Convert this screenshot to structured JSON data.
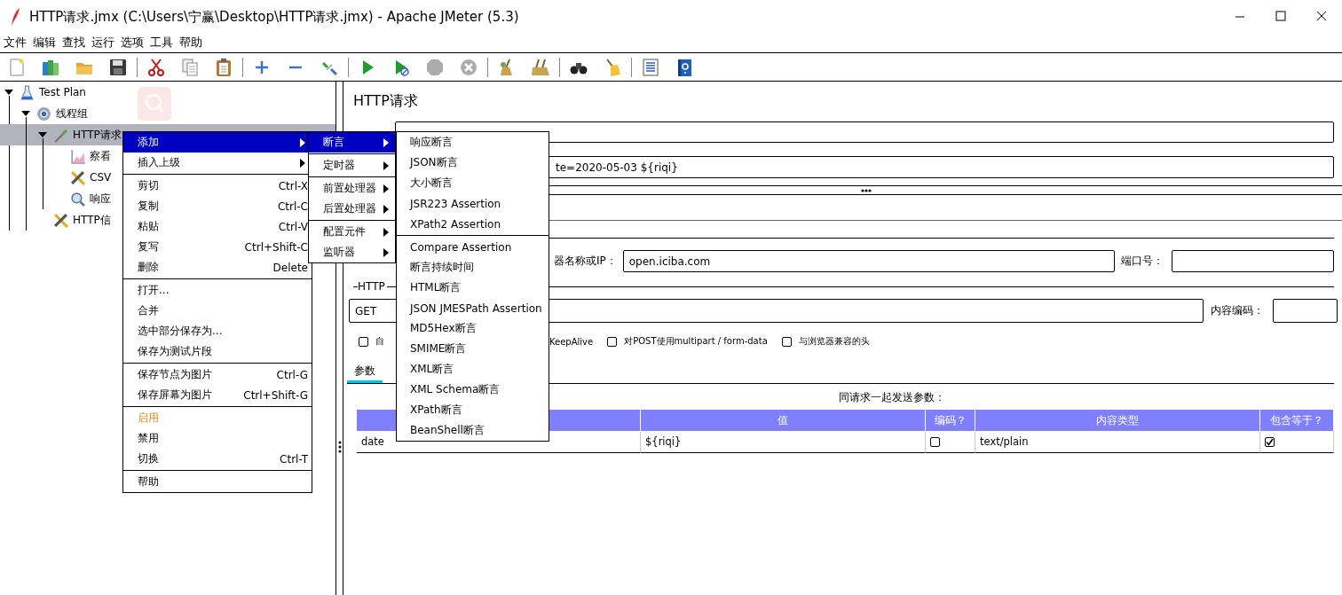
{
  "window": {
    "title": "HTTP请求.jmx (C:\\Users\\宁赢\\Desktop\\HTTP请求.jmx) - Apache JMeter (5.3)"
  },
  "menu_bar": [
    "文件",
    "编辑",
    "查找",
    "运行",
    "选项",
    "工具",
    "帮助"
  ],
  "toolbar": [
    [
      {
        "kind": "new",
        "disabled": false
      },
      {
        "kind": "templates",
        "disabled": false
      },
      {
        "kind": "open",
        "disabled": false
      },
      {
        "kind": "save",
        "disabled": false
      }
    ],
    [
      {
        "kind": "cut",
        "disabled": false
      },
      {
        "kind": "copy",
        "disabled": false
      },
      {
        "kind": "paste",
        "disabled": false
      }
    ],
    [
      {
        "kind": "expand",
        "disabled": false
      },
      {
        "kind": "collapse",
        "disabled": false
      },
      {
        "kind": "toggle",
        "disabled": false
      }
    ],
    [
      {
        "kind": "start",
        "disabled": false
      },
      {
        "kind": "start_no_pauses",
        "disabled": false
      },
      {
        "kind": "stop",
        "disabled": true
      },
      {
        "kind": "shutdown",
        "disabled": true
      }
    ],
    [
      {
        "kind": "clear",
        "disabled": false
      },
      {
        "kind": "clear_all",
        "disabled": false
      }
    ],
    [
      {
        "kind": "search",
        "disabled": false
      },
      {
        "kind": "reset_search",
        "disabled": false
      }
    ],
    [
      {
        "kind": "function_helper",
        "disabled": false
      },
      {
        "kind": "help",
        "disabled": false
      }
    ]
  ],
  "tree": [
    {
      "label": "Test Plan",
      "kind": "test_plan",
      "expanded": true,
      "selected": false,
      "children": [
        {
          "label": "线程组",
          "kind": "thread_group",
          "expanded": true,
          "selected": false,
          "children": [
            {
              "label": "HTTP请求",
              "kind": "sampler",
              "expanded": true,
              "selected": true,
              "children": [
                {
                  "label": "察看",
                  "kind": "listener",
                  "selected": false
                },
                {
                  "label": "CSV",
                  "kind": "config",
                  "selected": false
                },
                {
                  "label": "响应",
                  "kind": "assertion",
                  "selected": false
                }
              ]
            },
            {
              "label": "HTTP信",
              "kind": "config",
              "selected": false
            }
          ]
        }
      ]
    }
  ],
  "editor": {
    "title": "HTTP请求",
    "comment_value": "te=2020-05-03  ${riqi}",
    "server_label": "器名称或IP：",
    "server_value": "open.iciba.com",
    "port_label": "端口号：",
    "section_label": "HTTP",
    "method": "GET",
    "encoding_label": "内容编码：",
    "options": [
      {
        "label": "自",
        "checked": false
      },
      {
        "label": "对POST使用multipart / form-data",
        "checked": false
      },
      {
        "label": "与浏览器兼容的头",
        "checked": false
      }
    ],
    "keepalive_fragment": "KeepAlive",
    "tabs": [
      {
        "label": "参数",
        "selected": true
      }
    ],
    "params_caption": "同请求一起发送参数：",
    "table": {
      "columns": [
        "值",
        "编码？",
        "内容类型",
        "包含等于？"
      ],
      "rows": [
        {
          "name": "date",
          "value": "${riqi}",
          "encode": false,
          "content_type": "text/plain",
          "include_equals": true
        }
      ]
    }
  },
  "context_menu": {
    "groups": [
      [
        {
          "label": "添加",
          "has_submenu": true,
          "selected": true,
          "emphasized": false
        },
        {
          "label": "插入上级",
          "has_submenu": true,
          "selected": false,
          "emphasized": false
        }
      ],
      [
        {
          "label": "剪切",
          "shortcut": "Ctrl-X",
          "selected": false,
          "emphasized": false
        },
        {
          "label": "复制",
          "shortcut": "Ctrl-C",
          "selected": false,
          "emphasized": false
        },
        {
          "label": "粘贴",
          "shortcut": "Ctrl-V",
          "selected": false,
          "emphasized": false
        },
        {
          "label": "复写",
          "shortcut": "Ctrl+Shift-C",
          "selected": false,
          "emphasized": false
        },
        {
          "label": "删除",
          "shortcut": "Delete",
          "selected": false,
          "emphasized": false
        }
      ],
      [
        {
          "label": "打开...",
          "selected": false,
          "emphasized": false
        },
        {
          "label": "合并",
          "selected": false,
          "emphasized": false
        },
        {
          "label": "选中部分保存为...",
          "selected": false,
          "emphasized": false
        },
        {
          "label": "保存为测试片段",
          "selected": false,
          "emphasized": false
        }
      ],
      [
        {
          "label": "保存节点为图片",
          "shortcut": "Ctrl-G",
          "selected": false,
          "emphasized": false
        },
        {
          "label": "保存屏幕为图片",
          "shortcut": "Ctrl+Shift-G",
          "selected": false,
          "emphasized": false
        }
      ],
      [
        {
          "label": "启用",
          "selected": false,
          "emphasized": true
        },
        {
          "label": "禁用",
          "selected": false,
          "emphasized": false
        },
        {
          "label": "切换",
          "shortcut": "Ctrl-T",
          "selected": false,
          "emphasized": false
        }
      ],
      [
        {
          "label": "帮助",
          "selected": false,
          "emphasized": false
        }
      ]
    ]
  },
  "add_submenu": {
    "groups": [
      [
        {
          "label": "断言",
          "has_submenu": true,
          "selected": true
        }
      ],
      [
        {
          "label": "定时器",
          "has_submenu": true,
          "selected": false
        }
      ],
      [
        {
          "label": "前置处理器",
          "has_submenu": true,
          "selected": false
        },
        {
          "label": "后置处理器",
          "has_submenu": true,
          "selected": false
        }
      ],
      [
        {
          "label": "配置元件",
          "has_submenu": true,
          "selected": false
        },
        {
          "label": "监听器",
          "has_submenu": true,
          "selected": false
        }
      ]
    ]
  },
  "assertion_submenu": {
    "groups": [
      [
        {
          "label": "响应断言",
          "selected": false
        },
        {
          "label": "JSON断言",
          "selected": false
        },
        {
          "label": "大小断言",
          "selected": false
        },
        {
          "label": "JSR223 Assertion",
          "selected": false
        },
        {
          "label": "XPath2 Assertion",
          "selected": false
        }
      ],
      [
        {
          "label": "Compare Assertion",
          "selected": false
        },
        {
          "label": "断言持续时间",
          "selected": false
        },
        {
          "label": "HTML断言",
          "selected": false
        },
        {
          "label": "JSON JMESPath Assertion",
          "selected": false
        },
        {
          "label": "MD5Hex断言",
          "selected": false
        },
        {
          "label": "SMIME断言",
          "selected": false
        },
        {
          "label": "XML断言",
          "selected": false
        },
        {
          "label": "XML Schema断言",
          "selected": false
        },
        {
          "label": "XPath断言",
          "selected": false
        },
        {
          "label": "BeanShell断言",
          "selected": false
        }
      ]
    ]
  }
}
